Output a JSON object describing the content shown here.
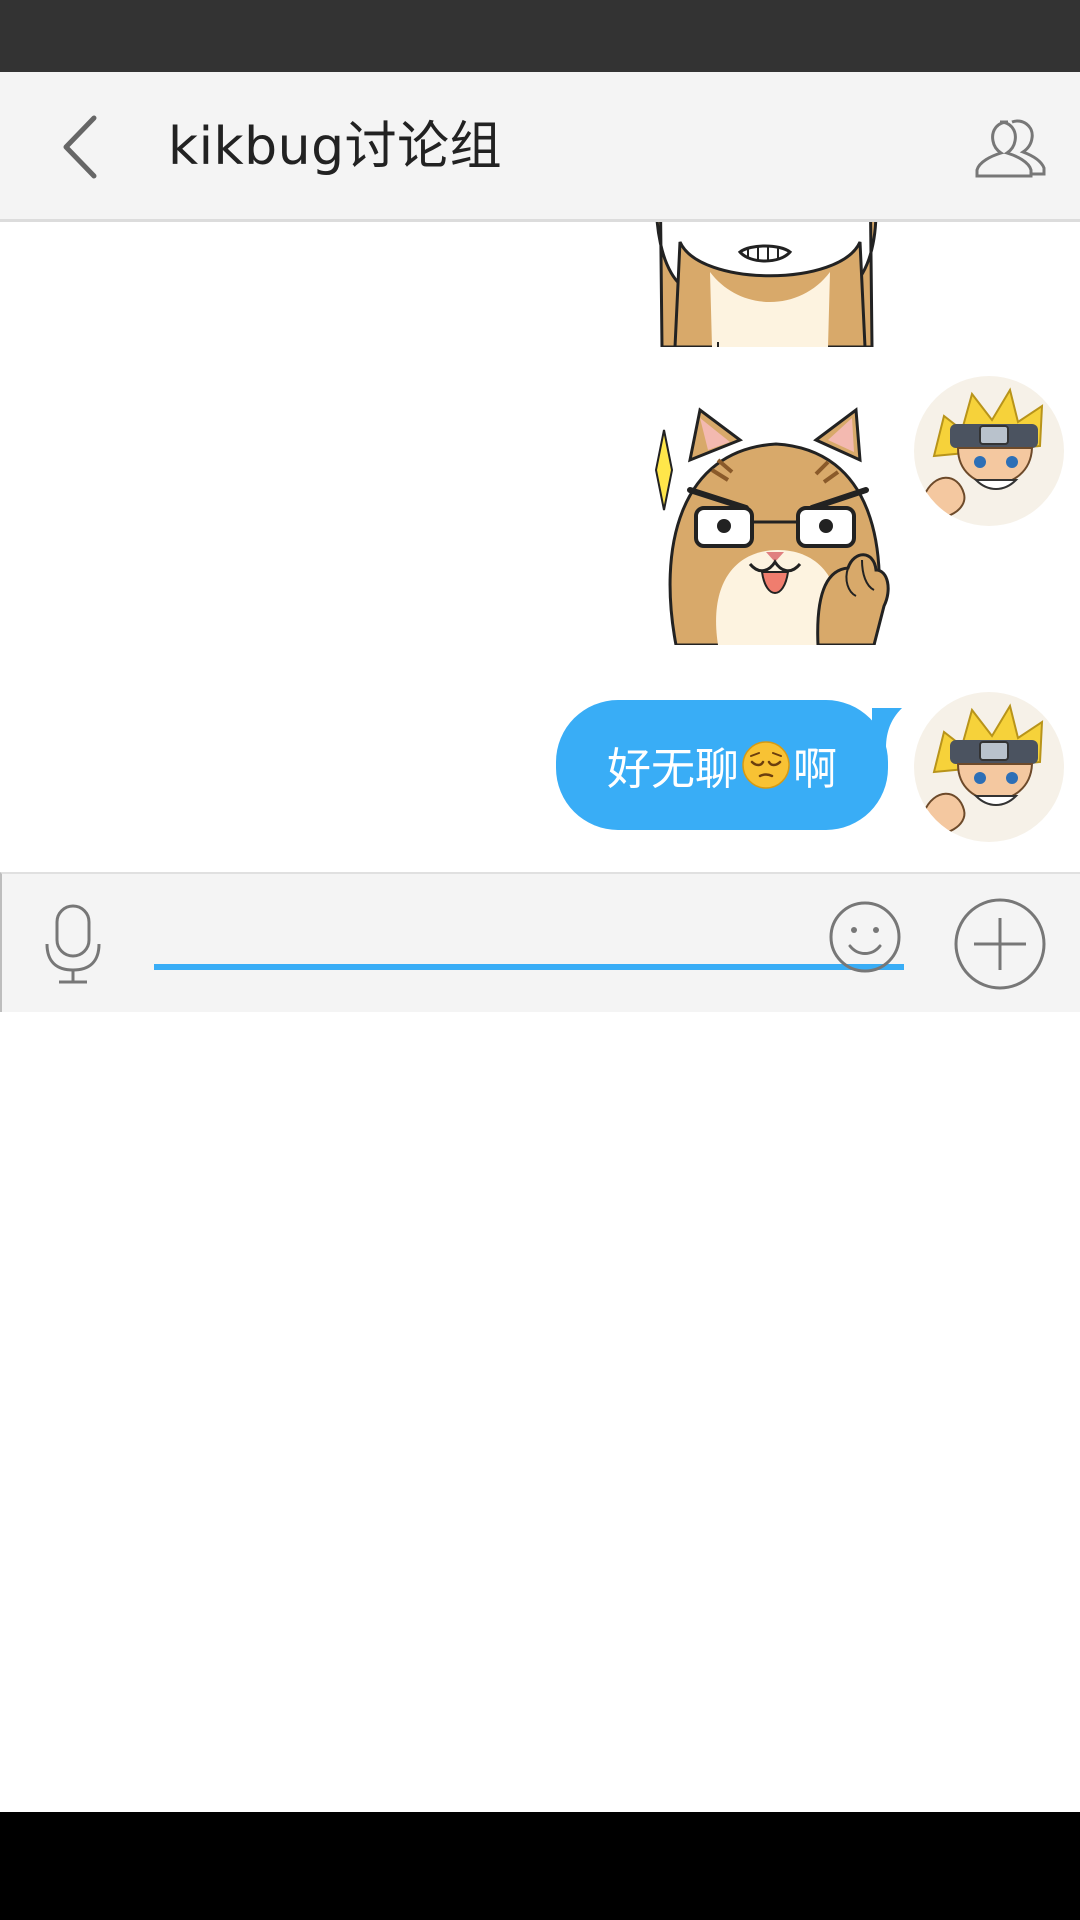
{
  "header": {
    "title": "kikbug讨论组"
  },
  "messages": [
    {
      "type": "sticker",
      "sticker_name": "cat-arms-raised-sticker"
    },
    {
      "type": "sticker",
      "sticker_name": "cat-determined-fist-sticker"
    },
    {
      "type": "text",
      "text_before": "好无聊",
      "emoji": "pensive-face-emoji",
      "text_after": "啊"
    }
  ],
  "composer": {
    "value": "",
    "placeholder": ""
  },
  "icons": {
    "back": "chevron-left-icon",
    "members": "group-members-icon",
    "mic": "microphone-icon",
    "emoji": "smiley-icon",
    "more": "plus-circle-icon"
  },
  "colors": {
    "accent": "#39adf6",
    "status_bar": "#333333",
    "title_bar": "#f4f4f4",
    "nav_bar": "#000000"
  }
}
